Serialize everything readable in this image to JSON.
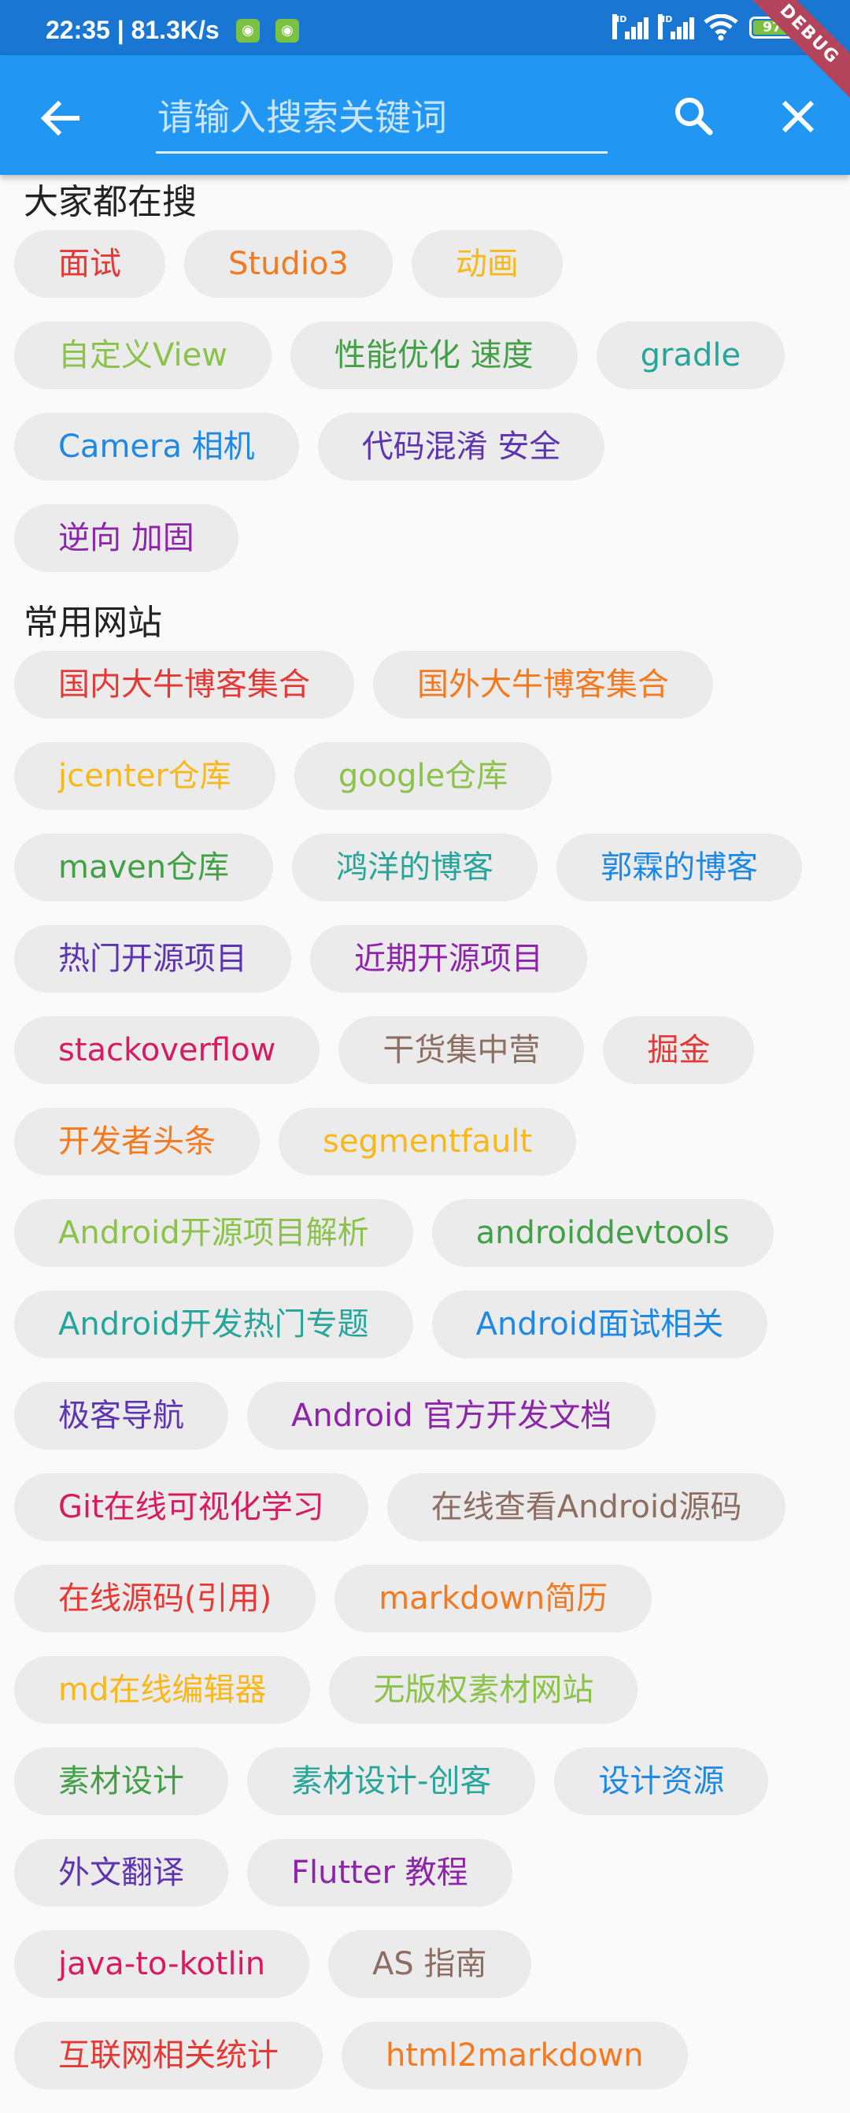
{
  "status_bar": {
    "time_speed": "22:35 | 81.3K/s",
    "network_label": "HD",
    "battery": "97",
    "debug_banner": "DEBUG"
  },
  "search": {
    "placeholder": "请输入搜索关键词"
  },
  "icons": {
    "back": "arrow-back-icon",
    "search": "search-icon",
    "close": "close-icon"
  },
  "sections": [
    {
      "title": "大家都在搜",
      "chips": [
        {
          "label": "面试",
          "color": "#e53935"
        },
        {
          "label": "Studio3",
          "color": "#f4791f"
        },
        {
          "label": "动画",
          "color": "#f9b81a"
        },
        {
          "label": "自定义View",
          "color": "#8bc34a"
        },
        {
          "label": "性能优化 速度",
          "color": "#43a047"
        },
        {
          "label": "gradle",
          "color": "#26a69a"
        },
        {
          "label": "Camera 相机",
          "color": "#1e88e5"
        },
        {
          "label": "代码混淆 安全",
          "color": "#5e35b1"
        },
        {
          "label": "逆向 加固",
          "color": "#8e24aa"
        }
      ]
    },
    {
      "title": "常用网站",
      "chips": [
        {
          "label": "国内大牛博客集合",
          "color": "#e53935"
        },
        {
          "label": "国外大牛博客集合",
          "color": "#f4791f"
        },
        {
          "label": "jcenter仓库",
          "color": "#f9b81a"
        },
        {
          "label": "google仓库",
          "color": "#8bc34a"
        },
        {
          "label": "maven仓库",
          "color": "#43a047"
        },
        {
          "label": "鸿洋的博客",
          "color": "#26a69a"
        },
        {
          "label": "郭霖的博客",
          "color": "#1e88e5"
        },
        {
          "label": "热门开源项目",
          "color": "#5e35b1"
        },
        {
          "label": "近期开源项目",
          "color": "#8e24aa"
        },
        {
          "label": "stackoverflow",
          "color": "#d81b60"
        },
        {
          "label": "干货集中营",
          "color": "#8d6e63"
        },
        {
          "label": "掘金",
          "color": "#e53935"
        },
        {
          "label": "开发者头条",
          "color": "#f4791f"
        },
        {
          "label": "segmentfault",
          "color": "#f9b81a"
        },
        {
          "label": "Android开源项目解析",
          "color": "#8bc34a"
        },
        {
          "label": "androiddevtools",
          "color": "#43a047"
        },
        {
          "label": "Android开发热门专题",
          "color": "#26a69a"
        },
        {
          "label": "Android面试相关",
          "color": "#1e88e5"
        },
        {
          "label": "极客导航",
          "color": "#5e35b1"
        },
        {
          "label": "Android 官方开发文档",
          "color": "#8e24aa"
        },
        {
          "label": "Git在线可视化学习",
          "color": "#d81b60"
        },
        {
          "label": "在线查看Android源码",
          "color": "#8d6e63"
        },
        {
          "label": "在线源码(引用)",
          "color": "#e53935"
        },
        {
          "label": "markdown简历",
          "color": "#f4791f"
        },
        {
          "label": "md在线编辑器",
          "color": "#f9b81a"
        },
        {
          "label": "无版权素材网站",
          "color": "#8bc34a"
        },
        {
          "label": "素材设计",
          "color": "#43a047"
        },
        {
          "label": "素材设计-创客",
          "color": "#26a69a"
        },
        {
          "label": "设计资源",
          "color": "#1e88e5"
        },
        {
          "label": "外文翻译",
          "color": "#5e35b1"
        },
        {
          "label": "Flutter 教程",
          "color": "#8e24aa"
        },
        {
          "label": "java-to-kotlin",
          "color": "#d81b60"
        },
        {
          "label": "AS 指南",
          "color": "#8d6e63"
        },
        {
          "label": "互联网相关统计",
          "color": "#e53935"
        },
        {
          "label": "html2markdown",
          "color": "#f4791f"
        }
      ]
    }
  ]
}
